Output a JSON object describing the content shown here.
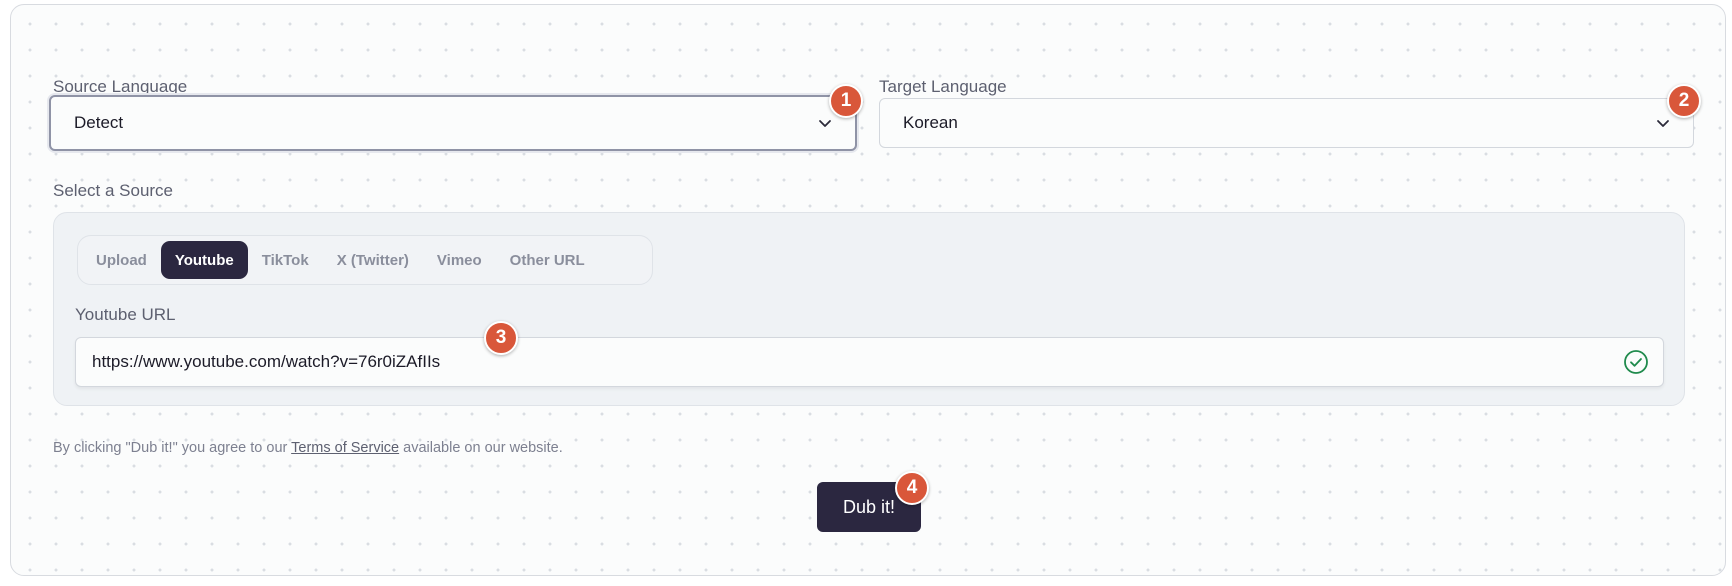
{
  "source_language": {
    "label": "Source Language",
    "value": "Detect",
    "badge": "1"
  },
  "target_language": {
    "label": "Target Language",
    "value": "Korean",
    "badge": "2"
  },
  "source": {
    "label": "Select a Source",
    "tabs": [
      {
        "label": "Upload",
        "active": false
      },
      {
        "label": "Youtube",
        "active": true
      },
      {
        "label": "TikTok",
        "active": false
      },
      {
        "label": "X (Twitter)",
        "active": false
      },
      {
        "label": "Vimeo",
        "active": false
      },
      {
        "label": "Other URL",
        "active": false
      }
    ],
    "url_label": "Youtube URL",
    "url_value": "https://www.youtube.com/watch?v=76r0iZAfIIs",
    "url_badge": "3",
    "valid_icon": "check-circle-icon"
  },
  "terms": {
    "prefix": "By clicking \"Dub it!\" you agree to our",
    "link": "Terms of Service",
    "suffix": "available on our website."
  },
  "dub_button": {
    "label": "Dub it!",
    "badge": "4"
  },
  "colors": {
    "accent_dark": "#2b2740",
    "badge": "#d9573a",
    "valid_green": "#1f8a4c"
  }
}
